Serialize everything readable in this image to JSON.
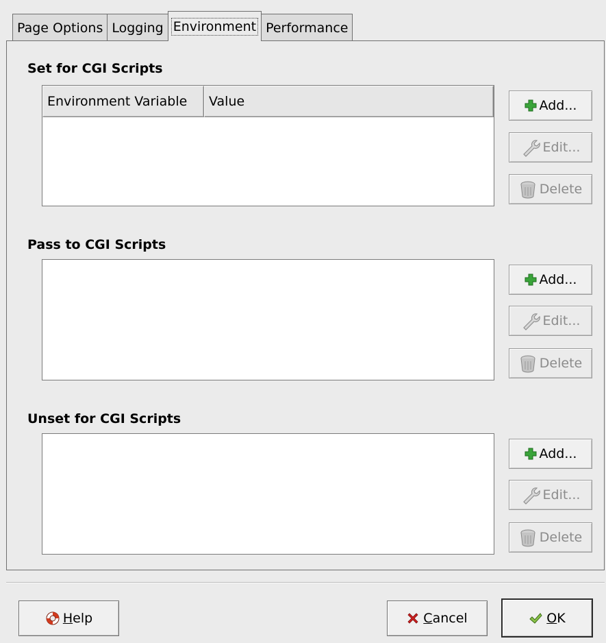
{
  "tabs": [
    {
      "label": "Page Options",
      "active": false
    },
    {
      "label": "Logging",
      "active": false
    },
    {
      "label": "Environment",
      "active": true
    },
    {
      "label": "Performance",
      "active": false
    }
  ],
  "set_section": {
    "title": "Set for CGI Scripts",
    "columns": [
      "Environment Variable",
      "Value"
    ],
    "add_label": "Add...",
    "edit_label": "Edit...",
    "delete_label": "Delete"
  },
  "pass_section": {
    "title": "Pass to CGI Scripts",
    "add_label": "Add...",
    "edit_label": "Edit...",
    "delete_label": "Delete"
  },
  "unset_section": {
    "title": "Unset for CGI Scripts",
    "add_label": "Add...",
    "edit_label": "Edit...",
    "delete_label": "Delete"
  },
  "footer": {
    "help_mnemonic": "H",
    "help_rest": "elp",
    "cancel_mnemonic": "C",
    "cancel_rest": "ancel",
    "ok_mnemonic": "O",
    "ok_rest": "K"
  },
  "icons": {
    "add": "plus-icon",
    "edit": "wrench-icon",
    "delete": "trash-icon",
    "help": "lifebuoy-icon",
    "cancel": "cross-icon",
    "ok": "checkmark-icon"
  },
  "colors": {
    "add_icon": "#3aa43a",
    "cancel_icon": "#cc2020",
    "ok_icon": "#5aa02c",
    "help_icon": "#d23a1e"
  }
}
